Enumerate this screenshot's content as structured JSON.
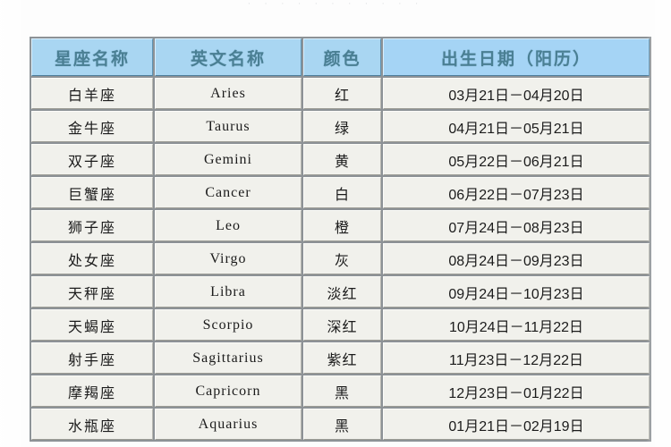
{
  "page": {
    "top_edge_remnant": "· · · · ·     · ·     · · · ·",
    "background_color": "#fdfdfd"
  },
  "table": {
    "name": "zodiac-sign-table",
    "header_bg_color": "#a9d6f2",
    "header_text_color": "#4a7f93",
    "cell_bg_color": "#f1f1ec",
    "border_color": "#8d9296",
    "columns": [
      {
        "key": "name",
        "label": "星座名称"
      },
      {
        "key": "en",
        "label": "英文名称"
      },
      {
        "key": "color",
        "label": "颜色"
      },
      {
        "key": "date",
        "label": "出生日期（阳历）"
      }
    ],
    "rows": [
      {
        "name": "白羊座",
        "en": "Aries",
        "color": "红",
        "date": "03月21日－04月20日"
      },
      {
        "name": "金牛座",
        "en": "Taurus",
        "color": "绿",
        "date": "04月21日－05月21日"
      },
      {
        "name": "双子座",
        "en": "Gemini",
        "color": "黄",
        "date": "05月22日－06月21日"
      },
      {
        "name": "巨蟹座",
        "en": "Cancer",
        "color": "白",
        "date": "06月22日－07月23日"
      },
      {
        "name": "狮子座",
        "en": "Leo",
        "color": "橙",
        "date": "07月24日－08月23日"
      },
      {
        "name": "处女座",
        "en": "Virgo",
        "color": "灰",
        "date": "08月24日－09月23日"
      },
      {
        "name": "天秤座",
        "en": "Libra",
        "color": "淡红",
        "date": "09月24日－10月23日"
      },
      {
        "name": "天蝎座",
        "en": "Scorpio",
        "color": "深红",
        "date": "10月24日－11月22日"
      },
      {
        "name": "射手座",
        "en": "Sagittarius",
        "color": "紫红",
        "date": "11月23日－12月22日"
      },
      {
        "name": "摩羯座",
        "en": "Capricorn",
        "color": "黑",
        "date": "12月23日－01月22日"
      },
      {
        "name": "水瓶座",
        "en": "Aquarius",
        "color": "黑",
        "date": "01月21日－02月19日"
      }
    ]
  }
}
